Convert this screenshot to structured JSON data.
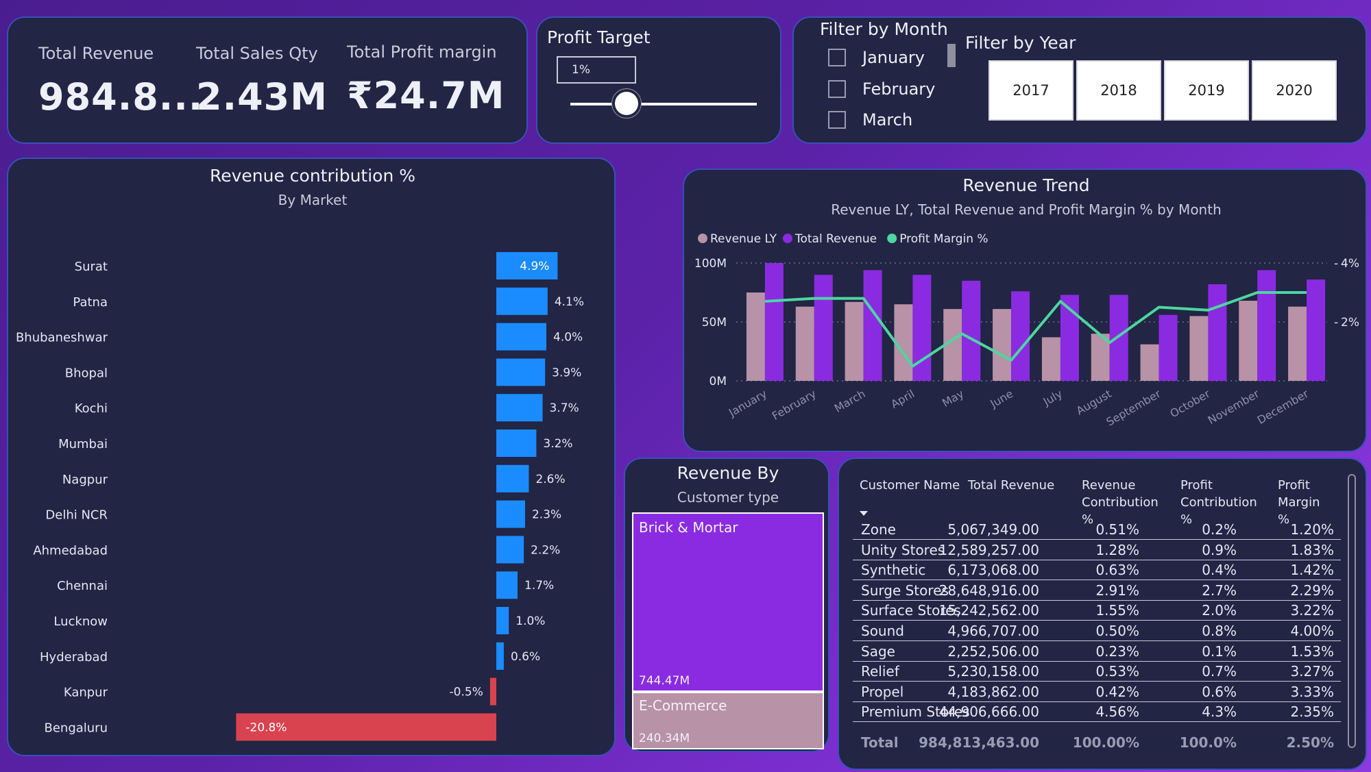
{
  "kpis": [
    {
      "label": "Total Revenue",
      "value": "984.8..."
    },
    {
      "label": "Total Sales Qty",
      "value": "2.43M"
    },
    {
      "label": "Total Profit margin",
      "value": "₹24.7M"
    }
  ],
  "profit_target": {
    "title": "Profit Target",
    "value": "1%",
    "slider_level": 0.3
  },
  "filter_month": {
    "title": "Filter by Month",
    "options": [
      "January",
      "February",
      "March"
    ]
  },
  "filter_year": {
    "title": "Filter by Year",
    "options": [
      "2017",
      "2018",
      "2019",
      "2020"
    ]
  },
  "market_chart": {
    "title": "Revenue contribution %",
    "subtitle": "By Market"
  },
  "trend_chart": {
    "title": "Revenue Trend",
    "subtitle": "Revenue LY, Total Revenue and Profit Margin % by Month"
  },
  "customer_type": {
    "title": "Revenue By",
    "subtitle": "Customer type",
    "cells": [
      {
        "label": "Brick & Mortar",
        "value": "744.47M",
        "amount": 744.47
      },
      {
        "label": "E-Commerce",
        "value": "240.34M",
        "amount": 240.34
      }
    ]
  },
  "customer_table": {
    "headers": [
      "Customer Name",
      "Total Revenue",
      "Revenue Contribution %",
      "Profit Contribution %",
      "Profit Margin %"
    ],
    "rows": [
      [
        "Zone",
        "5,067,349.00",
        "0.51%",
        "0.2%",
        "1.20%"
      ],
      [
        "Unity Stores",
        "12,589,257.00",
        "1.28%",
        "0.9%",
        "1.83%"
      ],
      [
        "Synthetic",
        "6,173,068.00",
        "0.63%",
        "0.4%",
        "1.42%"
      ],
      [
        "Surge Stores",
        "28,648,916.00",
        "2.91%",
        "2.7%",
        "2.29%"
      ],
      [
        "Surface Stores",
        "15,242,562.00",
        "1.55%",
        "2.0%",
        "3.22%"
      ],
      [
        "Sound",
        "4,966,707.00",
        "0.50%",
        "0.8%",
        "4.00%"
      ],
      [
        "Sage",
        "2,252,506.00",
        "0.23%",
        "0.1%",
        "1.53%"
      ],
      [
        "Relief",
        "5,230,158.00",
        "0.53%",
        "0.7%",
        "3.27%"
      ],
      [
        "Propel",
        "4,183,862.00",
        "0.42%",
        "0.6%",
        "3.33%"
      ],
      [
        "Premium Stores",
        "44,906,666.00",
        "4.56%",
        "4.3%",
        "2.35%"
      ]
    ],
    "total": [
      "Total",
      "984,813,463.00",
      "100.00%",
      "100.0%",
      "2.50%"
    ]
  },
  "colors": {
    "positive_bar": "#1a8cff",
    "negative_bar": "#d9434f",
    "revenue_ly": "#b892a6",
    "total_revenue": "#8a2be2",
    "profit_margin": "#4dd6a0"
  },
  "chart_data": [
    {
      "type": "bar",
      "orientation": "horizontal",
      "title": "Revenue contribution %",
      "subtitle": "By Market",
      "categories": [
        "Surat",
        "Patna",
        "Bhubaneshwar",
        "Bhopal",
        "Kochi",
        "Mumbai",
        "Nagpur",
        "Delhi NCR",
        "Ahmedabad",
        "Chennai",
        "Lucknow",
        "Hyderabad",
        "Kanpur",
        "Bengaluru"
      ],
      "values": [
        4.9,
        4.1,
        4.0,
        3.9,
        3.7,
        3.2,
        2.6,
        2.3,
        2.2,
        1.7,
        1.0,
        0.6,
        -0.5,
        -20.8
      ],
      "labels": [
        "4.9%",
        "4.1%",
        "4.0%",
        "3.9%",
        "3.7%",
        "3.2%",
        "2.6%",
        "2.3%",
        "2.2%",
        "1.7%",
        "1.0%",
        "0.6%",
        "-0.5%",
        "-20.8%"
      ],
      "grid": false
    },
    {
      "type": "bar",
      "title": "Revenue Trend",
      "subtitle": "Revenue LY, Total Revenue and Profit Margin % by Month",
      "categories": [
        "January",
        "February",
        "March",
        "April",
        "May",
        "June",
        "July",
        "August",
        "September",
        "October",
        "November",
        "December"
      ],
      "series": [
        {
          "name": "Revenue LY",
          "kind": "bar",
          "axis": "left",
          "values": [
            75,
            63,
            67,
            65,
            61,
            61,
            37,
            40,
            31,
            55,
            68,
            63
          ]
        },
        {
          "name": "Total Revenue",
          "kind": "bar",
          "axis": "left",
          "values": [
            100,
            90,
            94,
            90,
            85,
            76,
            73,
            73,
            56,
            82,
            94,
            86
          ]
        },
        {
          "name": "Profit Margin %",
          "kind": "line",
          "axis": "right",
          "values": [
            2.7,
            2.8,
            2.8,
            0.5,
            1.6,
            0.7,
            2.7,
            1.3,
            2.5,
            2.4,
            3.0,
            3.0
          ]
        }
      ],
      "left_axis": {
        "ylim": [
          0,
          100
        ],
        "ticks": [
          "0M",
          "50M",
          "100M"
        ],
        "tick_values": [
          0,
          50,
          100
        ]
      },
      "right_axis": {
        "ylim": [
          0,
          4
        ],
        "ticks": [
          "2%",
          "4%"
        ],
        "tick_values": [
          2,
          4
        ]
      },
      "legend": "top-left",
      "grid": true
    }
  ]
}
